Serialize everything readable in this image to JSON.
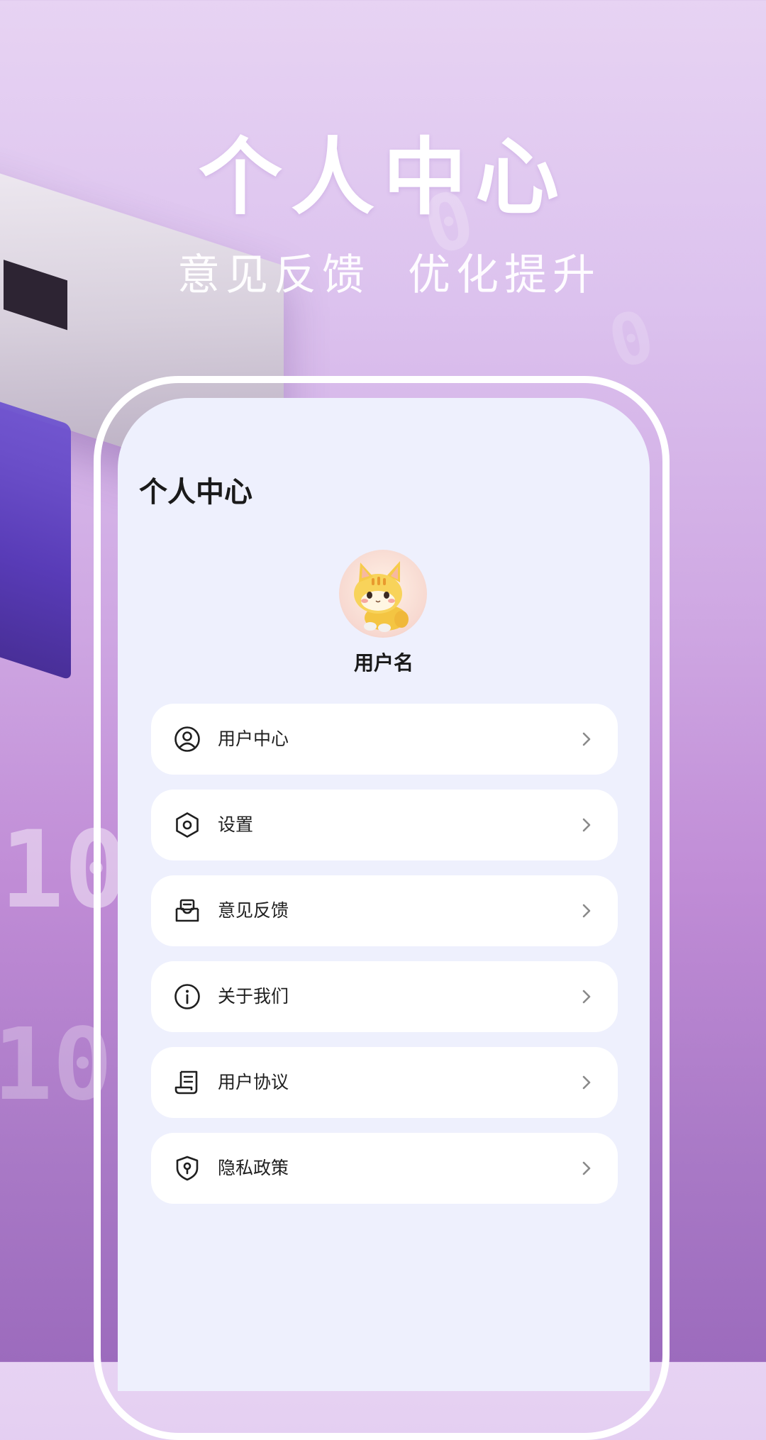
{
  "promo": {
    "headline": "个人中心",
    "subtitle_left": "意见反馈",
    "subtitle_right": "优化提升",
    "background_digits": [
      "10",
      "10",
      "0",
      "0"
    ]
  },
  "screen": {
    "page_title": "个人中心",
    "user": {
      "username": "用户名",
      "avatar_icon": "cat-avatar-icon"
    },
    "menu": [
      {
        "label": "用户中心",
        "icon": "user-circle-icon"
      },
      {
        "label": "设置",
        "icon": "settings-hexagon-icon"
      },
      {
        "label": "意见反馈",
        "icon": "feedback-inbox-icon"
      },
      {
        "label": "关于我们",
        "icon": "info-icon"
      },
      {
        "label": "用户协议",
        "icon": "document-scroll-icon"
      },
      {
        "label": "隐私政策",
        "icon": "shield-lock-icon"
      }
    ]
  },
  "colors": {
    "screen_background": "#eef0fd",
    "card_background": "#ffffff",
    "text_primary": "#1a1a1a",
    "frame": "#ffffff",
    "background_purple": "#c08cd6"
  }
}
